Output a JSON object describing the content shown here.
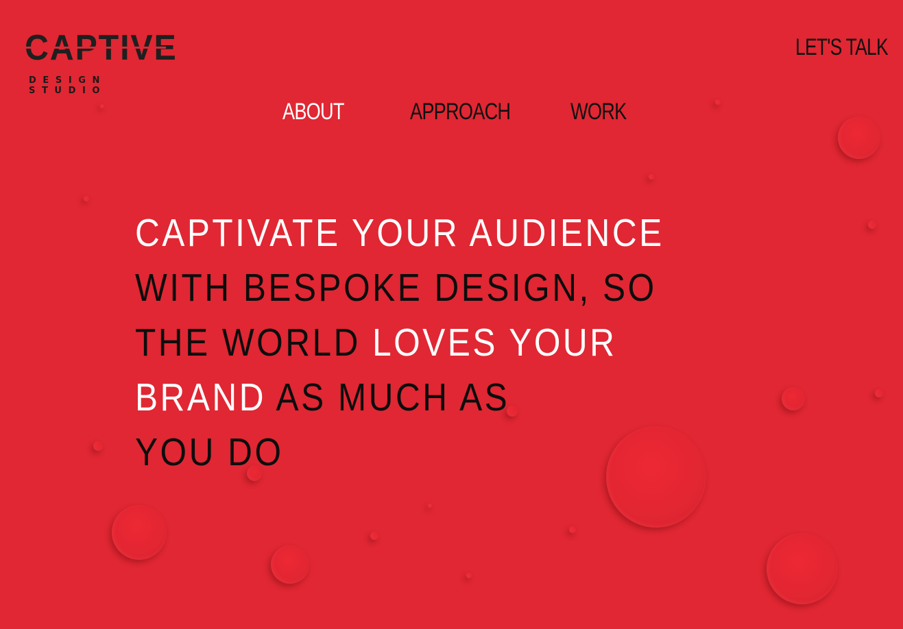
{
  "brand": {
    "logo_word": "CAPTIVE",
    "logo_sub": "DESIGN STUDIO"
  },
  "header": {
    "cta_label": "LET'S TALK"
  },
  "nav": {
    "items": [
      {
        "label": "ABOUT",
        "state": "active"
      },
      {
        "label": "APPROACH",
        "state": "inactive"
      },
      {
        "label": "WORK",
        "state": "inactive"
      }
    ]
  },
  "hero": {
    "lines": [
      [
        {
          "text": "CAPTIVATE YOUR AUDIENCE",
          "tone": "white"
        }
      ],
      [
        {
          "text": "WITH BESPOKE DESIGN, SO",
          "tone": "black"
        }
      ],
      [
        {
          "text": "THE WORLD ",
          "tone": "black"
        },
        {
          "text": "LOVES YOUR",
          "tone": "white"
        }
      ],
      [
        {
          "text": "BRAND ",
          "tone": "white"
        },
        {
          "text": "AS MUCH AS",
          "tone": "black"
        }
      ],
      [
        {
          "text": "YOU DO",
          "tone": "black"
        }
      ]
    ]
  },
  "colors": {
    "background": "#e02733",
    "text_dark": "#111111",
    "text_light": "#ffffff"
  }
}
